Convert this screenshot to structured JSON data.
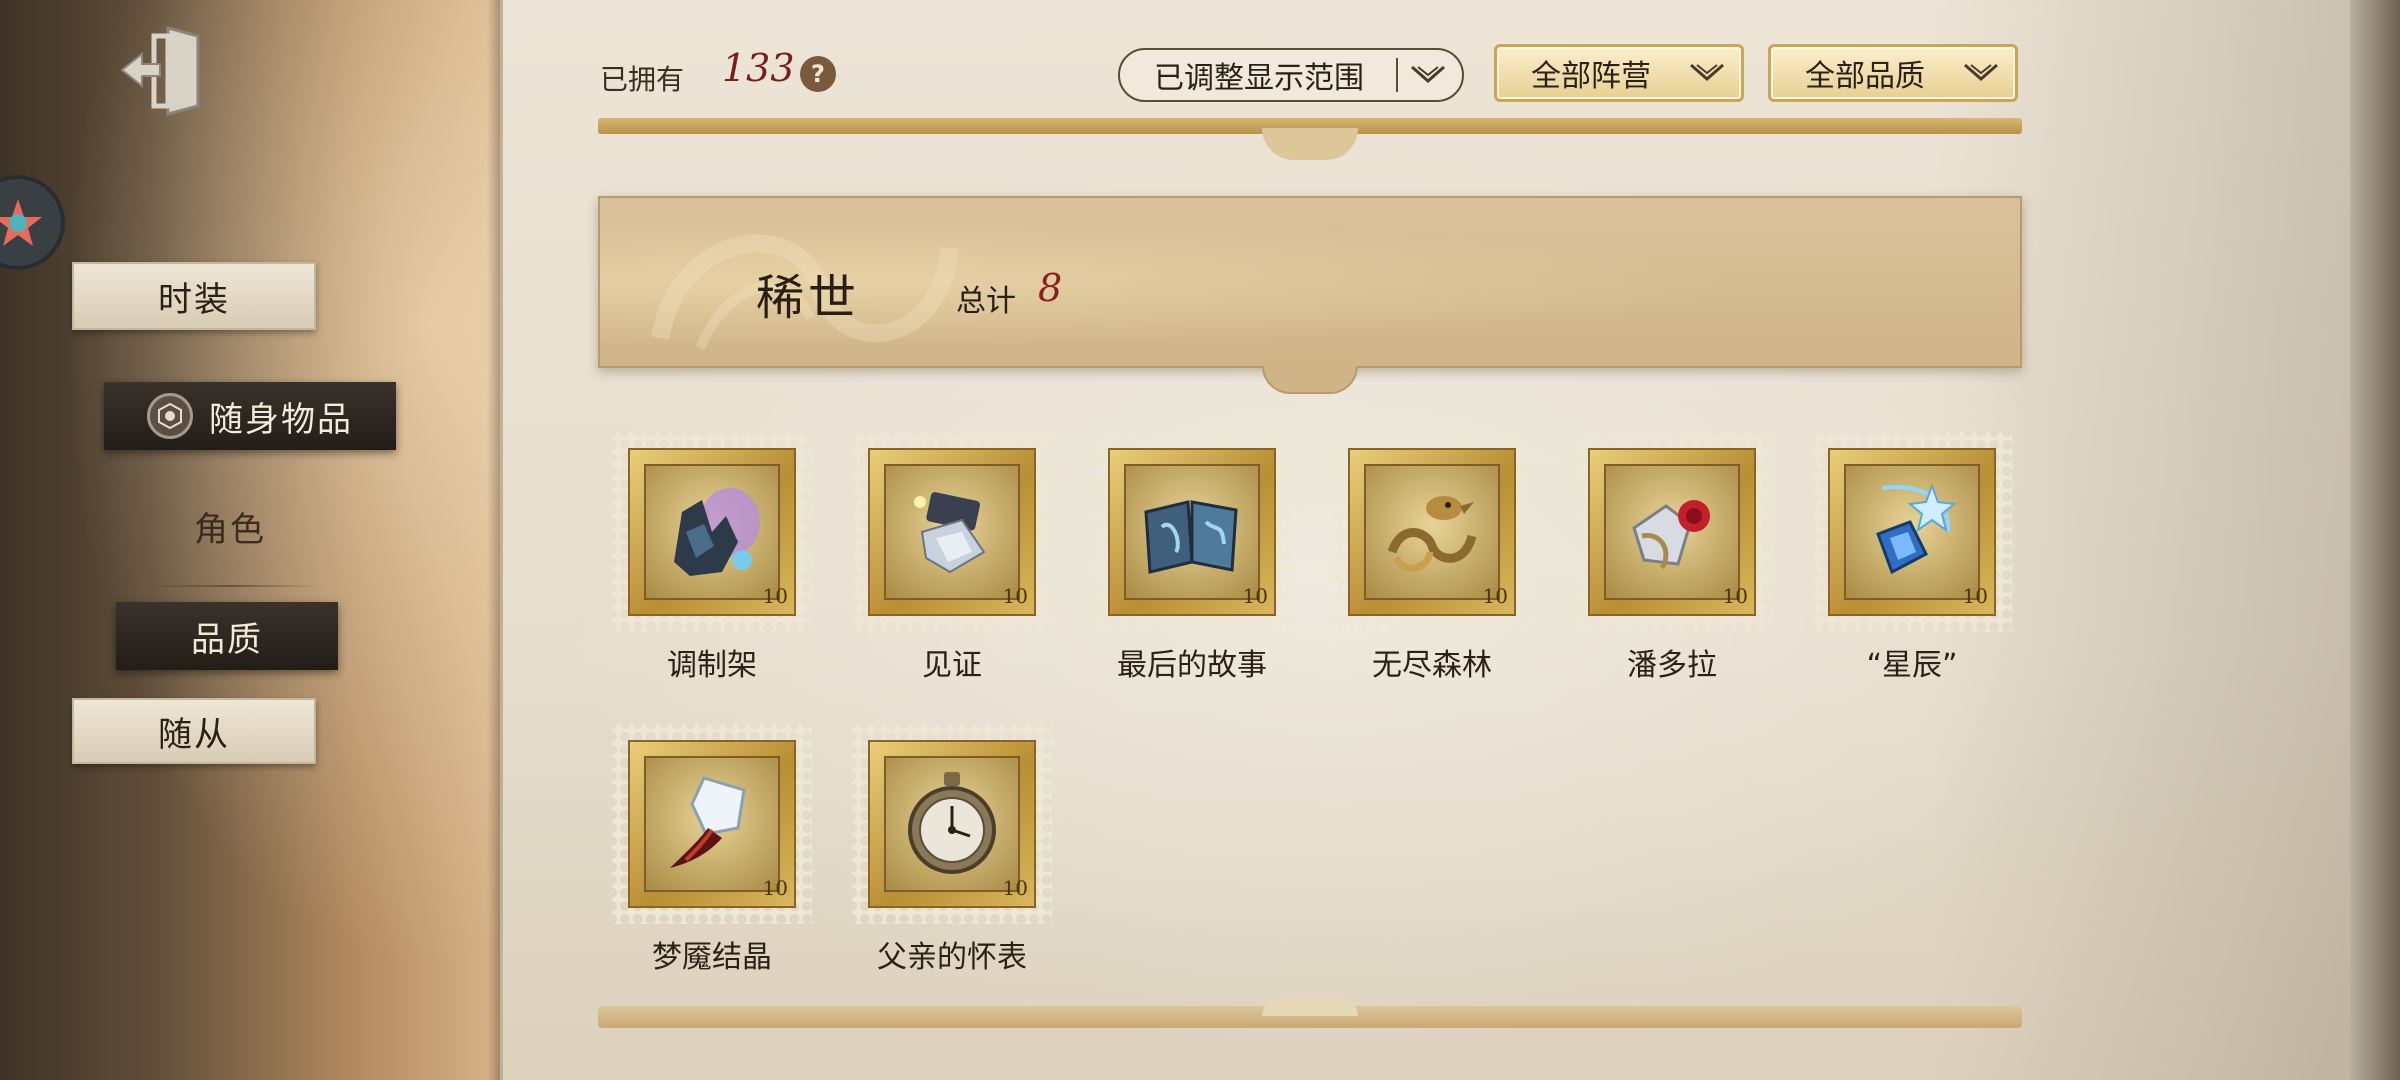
{
  "sidebar": {
    "nav": {
      "fashion": "时装",
      "accessories": "随身物品",
      "character": "角色",
      "quality": "品质",
      "follower": "随从"
    }
  },
  "header": {
    "owned_label": "已拥有",
    "owned_count": "133",
    "help_symbol": "?",
    "filters": {
      "range": "已调整显示范围",
      "faction": "全部阵营",
      "quality": "全部品质"
    }
  },
  "section": {
    "title": "稀世",
    "total_label": "总计",
    "total_count": "8"
  },
  "items": [
    {
      "name": "调制架",
      "icon": "modulator-rack-icon",
      "stamp_value": "10"
    },
    {
      "name": "见证",
      "icon": "witness-crystal-icon",
      "stamp_value": "10"
    },
    {
      "name": "最后的故事",
      "icon": "last-story-book-icon",
      "stamp_value": "10"
    },
    {
      "name": "无尽森林",
      "icon": "endless-forest-bird-icon",
      "stamp_value": "10"
    },
    {
      "name": "潘多拉",
      "icon": "pandora-rose-icon",
      "stamp_value": "10"
    },
    {
      "name": "“星辰”",
      "icon": "star-charm-icon",
      "stamp_value": "10"
    },
    {
      "name": "梦魇结晶",
      "icon": "nightmare-crystal-icon",
      "stamp_value": "10"
    },
    {
      "name": "父亲的怀表",
      "icon": "pocket-watch-icon",
      "stamp_value": "10"
    }
  ],
  "colors": {
    "accent_gold": "#c9a758",
    "count_red": "#7a1e1e",
    "nav_active_dark": "#231d18"
  }
}
